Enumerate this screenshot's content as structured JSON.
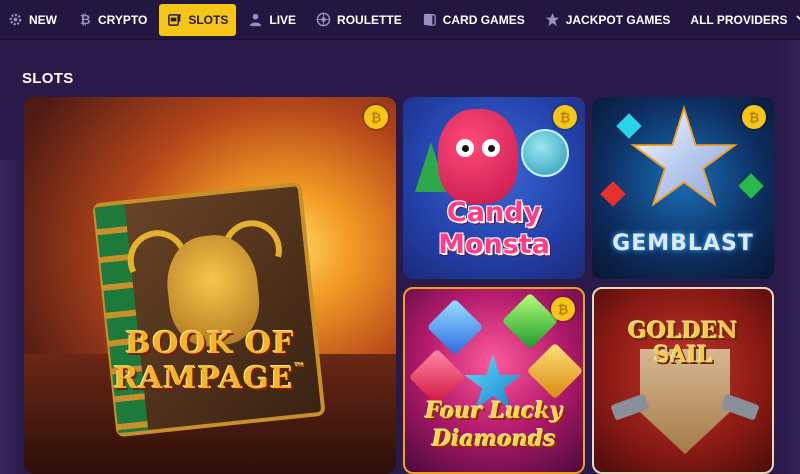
{
  "nav": {
    "items": [
      {
        "label": "NEW",
        "icon": "gear-icon",
        "active": false
      },
      {
        "label": "CRYPTO",
        "icon": "bitcoin-icon",
        "active": false
      },
      {
        "label": "SLOTS",
        "icon": "slot-machine-icon",
        "active": true
      },
      {
        "label": "LIVE",
        "icon": "dealer-icon",
        "active": false
      },
      {
        "label": "ROULETTE",
        "icon": "roulette-icon",
        "active": false
      },
      {
        "label": "CARD GAMES",
        "icon": "cards-icon",
        "active": false
      },
      {
        "label": "JACKPOT GAMES",
        "icon": "star-icon",
        "active": false
      }
    ],
    "providers_label": "ALL PROVIDERS"
  },
  "section": {
    "title": "SLOTS"
  },
  "games": [
    {
      "name": "BOOK OF RAMPAGE",
      "tm": "™",
      "badge": "₿"
    },
    {
      "name_line1": "Candy",
      "name_line2": "Monsta",
      "badge": "₿"
    },
    {
      "name": "GEMBLAST",
      "badge": "₿"
    },
    {
      "name_line1": "Four Lucky",
      "name_line2": "Diamonds",
      "badge": "₿"
    },
    {
      "name_line1": "GOLDEN",
      "name_line2": "SAIL",
      "badge": ""
    }
  ],
  "colors": {
    "background": "#2a1a4a",
    "nav_background": "#231640",
    "active_tab": "#f5c518",
    "badge": "#f5c518"
  }
}
